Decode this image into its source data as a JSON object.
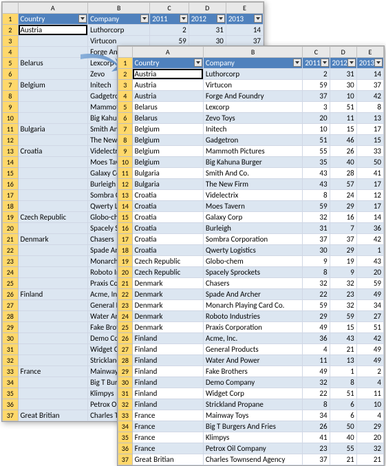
{
  "columns": [
    "A",
    "B",
    "C",
    "D",
    "E"
  ],
  "headers": {
    "country": "Country",
    "company": "Company",
    "y2011": "2011",
    "y2012": "2012",
    "y2013": "2013"
  },
  "back": {
    "active_cell": "A2",
    "rows": [
      {
        "n": 2,
        "country": "Austria",
        "company": "Luthorcorp",
        "v": [
          2,
          31,
          14
        ]
      },
      {
        "n": 3,
        "country": "",
        "company": "Virtucon",
        "v": [
          59,
          30,
          37
        ]
      },
      {
        "n": 4,
        "country": "",
        "company": "Forge And",
        "v": [
          "",
          "",
          ""
        ]
      },
      {
        "n": 5,
        "country": "Belarus",
        "company": "Lexcorp",
        "v": [
          "",
          "",
          ""
        ]
      },
      {
        "n": 6,
        "country": "",
        "company": "Zevo",
        "v": [
          "",
          "",
          ""
        ]
      },
      {
        "n": 7,
        "country": "Belgium",
        "company": "Initech",
        "v": [
          "",
          "",
          ""
        ]
      },
      {
        "n": 8,
        "country": "",
        "company": "Gadgetro",
        "v": [
          "",
          "",
          ""
        ]
      },
      {
        "n": 9,
        "country": "",
        "company": "Mammoth",
        "v": [
          "",
          "",
          ""
        ]
      },
      {
        "n": 10,
        "country": "",
        "company": "Big Kahun",
        "v": [
          "",
          "",
          ""
        ]
      },
      {
        "n": 11,
        "country": "Bulgaria",
        "company": "Smith And",
        "v": [
          "",
          "",
          ""
        ]
      },
      {
        "n": 12,
        "country": "",
        "company": "The New F",
        "v": [
          "",
          "",
          ""
        ]
      },
      {
        "n": 13,
        "country": "Croatia",
        "company": "Videlectri",
        "v": [
          "",
          "",
          ""
        ]
      },
      {
        "n": 14,
        "country": "",
        "company": "Moes Tave",
        "v": [
          "",
          "",
          ""
        ]
      },
      {
        "n": 15,
        "country": "",
        "company": "Galaxy Co",
        "v": [
          "",
          "",
          ""
        ]
      },
      {
        "n": 16,
        "country": "",
        "company": "Burleigh",
        "v": [
          "",
          "",
          ""
        ]
      },
      {
        "n": 17,
        "country": "",
        "company": "Sombra Co",
        "v": [
          "",
          "",
          ""
        ]
      },
      {
        "n": 18,
        "country": "",
        "company": "Qwerty Lo",
        "v": [
          "",
          "",
          ""
        ]
      },
      {
        "n": 19,
        "country": "Czech Republic",
        "company": "Globo-che",
        "v": [
          "",
          "",
          ""
        ]
      },
      {
        "n": 20,
        "country": "",
        "company": "Spacely Sp",
        "v": [
          "",
          "",
          ""
        ]
      },
      {
        "n": 21,
        "country": "Denmark",
        "company": "Chasers",
        "v": [
          "",
          "",
          ""
        ]
      },
      {
        "n": 22,
        "country": "",
        "company": "Spade And",
        "v": [
          "",
          "",
          ""
        ]
      },
      {
        "n": 23,
        "country": "",
        "company": "Monarch P",
        "v": [
          "",
          "",
          ""
        ]
      },
      {
        "n": 24,
        "country": "",
        "company": "Roboto In",
        "v": [
          "",
          "",
          ""
        ]
      },
      {
        "n": 25,
        "country": "",
        "company": "Praxis Cor",
        "v": [
          "",
          "",
          ""
        ]
      },
      {
        "n": 26,
        "country": "Finland",
        "company": "Acme, Inc",
        "v": [
          "",
          "",
          ""
        ]
      },
      {
        "n": 27,
        "country": "",
        "company": "General P",
        "v": [
          "",
          "",
          ""
        ]
      },
      {
        "n": 28,
        "country": "",
        "company": "Water And",
        "v": [
          "",
          "",
          ""
        ]
      },
      {
        "n": 29,
        "country": "",
        "company": "Fake Broth",
        "v": [
          "",
          "",
          ""
        ]
      },
      {
        "n": 30,
        "country": "",
        "company": "Demo Com",
        "v": [
          "",
          "",
          ""
        ]
      },
      {
        "n": 31,
        "country": "",
        "company": "Widget Co",
        "v": [
          "",
          "",
          ""
        ]
      },
      {
        "n": 32,
        "country": "",
        "company": "Strickland",
        "v": [
          "",
          "",
          ""
        ]
      },
      {
        "n": 33,
        "country": "France",
        "company": "Mainway T",
        "v": [
          "",
          "",
          ""
        ]
      },
      {
        "n": 34,
        "country": "",
        "company": "Big T Burg",
        "v": [
          "",
          "",
          ""
        ]
      },
      {
        "n": 35,
        "country": "",
        "company": "Klimpys",
        "v": [
          "",
          "",
          ""
        ]
      },
      {
        "n": 36,
        "country": "",
        "company": "Petrox Oil",
        "v": [
          "",
          "",
          ""
        ]
      },
      {
        "n": 37,
        "country": "Great Britian",
        "company": "Charles To",
        "v": [
          "",
          "",
          ""
        ]
      }
    ]
  },
  "front": {
    "active_cell": "A2",
    "rows": [
      {
        "n": 2,
        "country": "Austria",
        "company": "Luthorcorp",
        "v": [
          2,
          31,
          14
        ]
      },
      {
        "n": 3,
        "country": "Austria",
        "company": "Virtucon",
        "v": [
          59,
          30,
          37
        ]
      },
      {
        "n": 4,
        "country": "Austria",
        "company": "Forge And Foundry",
        "v": [
          37,
          10,
          42
        ]
      },
      {
        "n": 5,
        "country": "Belarus",
        "company": "Lexcorp",
        "v": [
          3,
          51,
          8
        ]
      },
      {
        "n": 6,
        "country": "Belarus",
        "company": "Zevo Toys",
        "v": [
          20,
          11,
          13
        ]
      },
      {
        "n": 7,
        "country": "Belgium",
        "company": "Initech",
        "v": [
          10,
          15,
          17
        ]
      },
      {
        "n": 8,
        "country": "Belgium",
        "company": "Gadgetron",
        "v": [
          51,
          46,
          15
        ]
      },
      {
        "n": 9,
        "country": "Belgium",
        "company": "Mammoth Pictures",
        "v": [
          55,
          26,
          33
        ]
      },
      {
        "n": 10,
        "country": "Belgium",
        "company": "Big Kahuna Burger",
        "v": [
          35,
          40,
          50
        ]
      },
      {
        "n": 11,
        "country": "Bulgaria",
        "company": "Smith And Co.",
        "v": [
          43,
          28,
          41
        ]
      },
      {
        "n": 12,
        "country": "Bulgaria",
        "company": "The New Firm",
        "v": [
          43,
          57,
          17
        ]
      },
      {
        "n": 13,
        "country": "Croatia",
        "company": "Videlectrix",
        "v": [
          8,
          24,
          12
        ]
      },
      {
        "n": 14,
        "country": "Croatia",
        "company": "Moes Tavern",
        "v": [
          59,
          29,
          17
        ]
      },
      {
        "n": 15,
        "country": "Croatia",
        "company": "Galaxy Corp",
        "v": [
          32,
          16,
          14
        ]
      },
      {
        "n": 16,
        "country": "Croatia",
        "company": "Burleigh",
        "v": [
          31,
          7,
          36
        ]
      },
      {
        "n": 17,
        "country": "Croatia",
        "company": "Sombra Corporation",
        "v": [
          37,
          37,
          42
        ]
      },
      {
        "n": 18,
        "country": "Croatia",
        "company": "Qwerty Logistics",
        "v": [
          30,
          29,
          1
        ]
      },
      {
        "n": 19,
        "country": "Czech Republic",
        "company": "Globo-chem",
        "v": [
          9,
          19,
          43
        ]
      },
      {
        "n": 20,
        "country": "Czech Republic",
        "company": "Spacely Sprockets",
        "v": [
          8,
          9,
          20
        ]
      },
      {
        "n": 21,
        "country": "Denmark",
        "company": "Chasers",
        "v": [
          32,
          32,
          59
        ]
      },
      {
        "n": 22,
        "country": "Denmark",
        "company": "Spade And Archer",
        "v": [
          22,
          23,
          49
        ]
      },
      {
        "n": 23,
        "country": "Denmark",
        "company": "Monarch Playing Card Co.",
        "v": [
          59,
          32,
          34
        ]
      },
      {
        "n": 24,
        "country": "Denmark",
        "company": "Roboto Industries",
        "v": [
          29,
          59,
          27
        ]
      },
      {
        "n": 25,
        "country": "Denmark",
        "company": "Praxis Corporation",
        "v": [
          49,
          15,
          51
        ]
      },
      {
        "n": 26,
        "country": "Finland",
        "company": "Acme, Inc.",
        "v": [
          36,
          43,
          42
        ]
      },
      {
        "n": 27,
        "country": "Finland",
        "company": "General Products",
        "v": [
          4,
          21,
          49
        ]
      },
      {
        "n": 28,
        "country": "Finland",
        "company": "Water And Power",
        "v": [
          11,
          13,
          49
        ]
      },
      {
        "n": 29,
        "country": "Finland",
        "company": "Fake Brothers",
        "v": [
          49,
          1,
          2
        ]
      },
      {
        "n": 30,
        "country": "Finland",
        "company": "Demo Company",
        "v": [
          32,
          8,
          4
        ]
      },
      {
        "n": 31,
        "country": "Finland",
        "company": "Widget Corp",
        "v": [
          22,
          51,
          11
        ]
      },
      {
        "n": 32,
        "country": "Finland",
        "company": "Strickland Propane",
        "v": [
          8,
          6,
          10
        ]
      },
      {
        "n": 33,
        "country": "France",
        "company": "Mainway Toys",
        "v": [
          34,
          6,
          4
        ]
      },
      {
        "n": 34,
        "country": "France",
        "company": "Big T Burgers And Fries",
        "v": [
          26,
          50,
          29
        ]
      },
      {
        "n": 35,
        "country": "France",
        "company": "Klimpys",
        "v": [
          41,
          40,
          20
        ]
      },
      {
        "n": 36,
        "country": "France",
        "company": "Petrox Oil Company",
        "v": [
          23,
          55,
          32
        ]
      },
      {
        "n": 37,
        "country": "Great Britian",
        "company": "Charles Townsend Agency",
        "v": [
          37,
          21,
          21
        ]
      }
    ]
  }
}
